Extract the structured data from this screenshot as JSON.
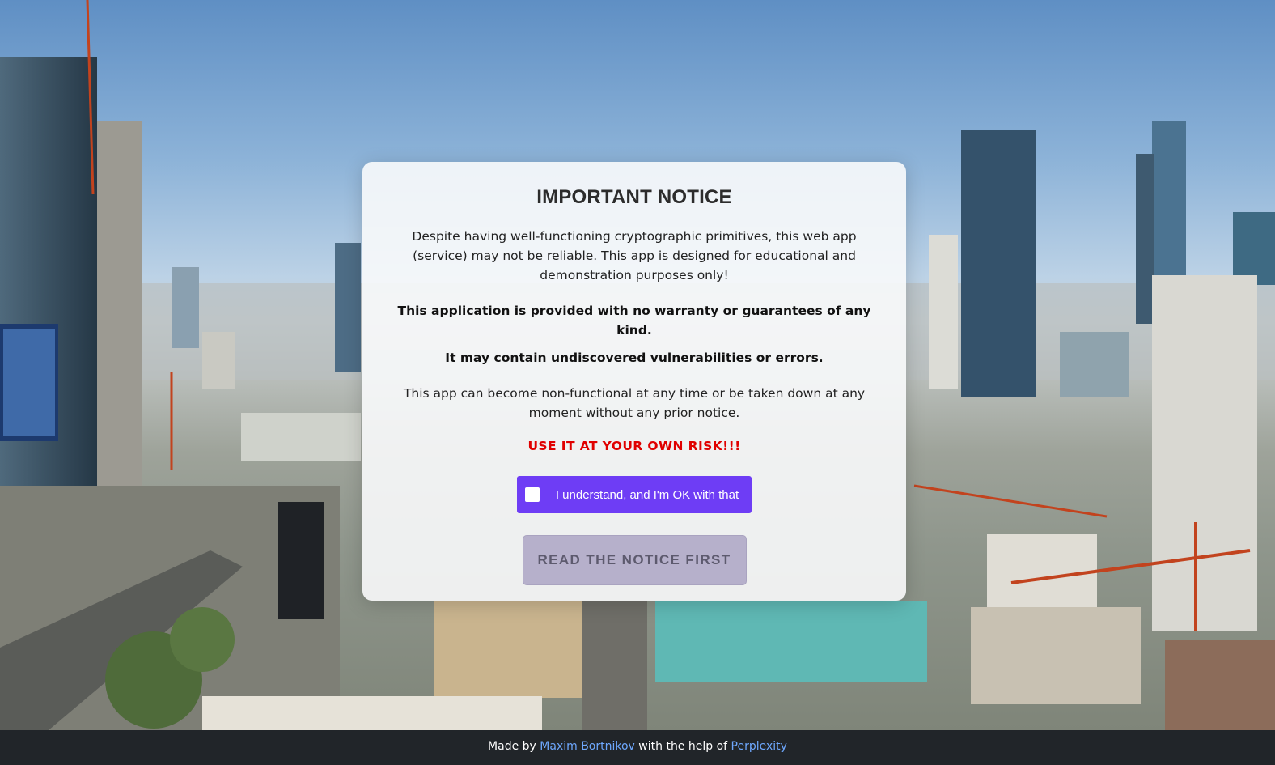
{
  "notice": {
    "title": "IMPORTANT NOTICE",
    "paragraph1": "Despite having well-functioning cryptographic primitives, this web app (service) may not be reliable. This app is designed for educational and demonstration purposes only!",
    "bold1": "This application is provided with no warranty or guarantees of any kind.",
    "bold2": "It may contain undiscovered vulnerabilities or errors.",
    "paragraph2": "This app can become non-functional at any time or be taken down at any moment without any prior notice.",
    "warning": "USE IT AT YOUR OWN RISK!!!",
    "checkbox_label": "I understand, and I'm OK with that",
    "checkbox_checked": false,
    "button_label": "READ THE NOTICE FIRST",
    "button_disabled": true
  },
  "footer": {
    "made_by": "Made by",
    "author": "Maxim Bortnikov",
    "with_help": "with the help of",
    "helper": "Perplexity"
  },
  "colors": {
    "accent": "#6e3df5",
    "warning": "#e00000",
    "link": "#6ea8fe",
    "footer_bg": "#212529"
  }
}
